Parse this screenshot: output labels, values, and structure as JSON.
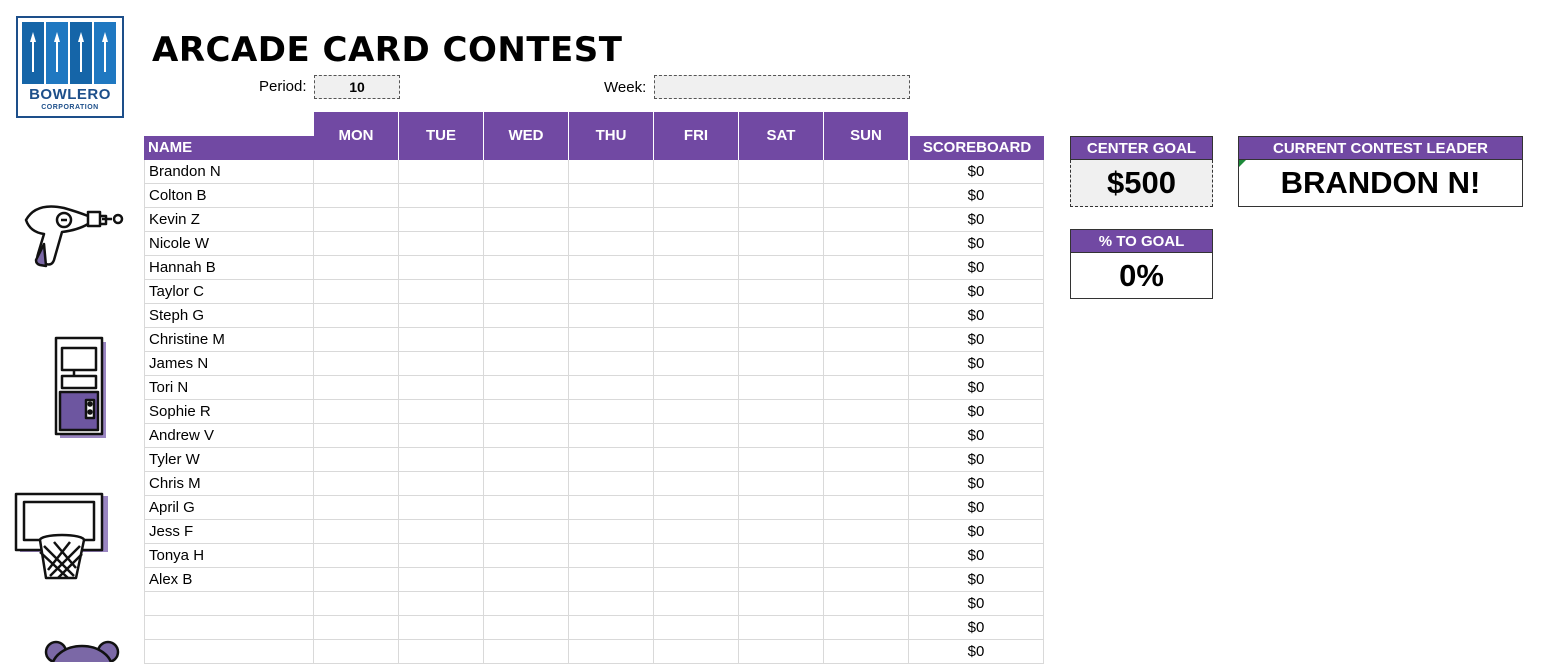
{
  "logo": {
    "name": "BOWLERO",
    "sub": "CORPORATION"
  },
  "title": "ARCADE CARD CONTEST",
  "period": {
    "label": "Period:",
    "value": "10"
  },
  "week": {
    "label": "Week:",
    "value": ""
  },
  "table": {
    "name_header": "NAME",
    "days": [
      "MON",
      "TUE",
      "WED",
      "THU",
      "FRI",
      "SAT",
      "SUN"
    ],
    "score_header": "SCOREBOARD",
    "rows": [
      {
        "name": "Brandon N",
        "score": "$0"
      },
      {
        "name": "Colton B",
        "score": "$0"
      },
      {
        "name": "Kevin Z",
        "score": "$0"
      },
      {
        "name": "Nicole W",
        "score": "$0"
      },
      {
        "name": "Hannah B",
        "score": "$0"
      },
      {
        "name": "Taylor C",
        "score": "$0"
      },
      {
        "name": "Steph G",
        "score": "$0"
      },
      {
        "name": "Christine M",
        "score": "$0"
      },
      {
        "name": "James N",
        "score": "$0"
      },
      {
        "name": "Tori N",
        "score": "$0"
      },
      {
        "name": "Sophie R",
        "score": "$0"
      },
      {
        "name": "Andrew V",
        "score": "$0"
      },
      {
        "name": "Tyler W",
        "score": "$0"
      },
      {
        "name": "Chris M",
        "score": "$0"
      },
      {
        "name": "April G",
        "score": "$0"
      },
      {
        "name": "Jess F",
        "score": "$0"
      },
      {
        "name": "Tonya H",
        "score": "$0"
      },
      {
        "name": "Alex B",
        "score": "$0"
      },
      {
        "name": "",
        "score": "$0"
      },
      {
        "name": "",
        "score": "$0"
      },
      {
        "name": "",
        "score": "$0"
      }
    ]
  },
  "center_goal": {
    "label": "CENTER GOAL",
    "value": "$500"
  },
  "pct_goal": {
    "label": "% TO GOAL",
    "value": "0%"
  },
  "leader": {
    "label": "CURRENT CONTEST LEADER",
    "value": "BRANDON N!"
  },
  "colors": {
    "accent": "#7149a3",
    "brand_blue": "#1565a8"
  },
  "icons": [
    "bowlero-logo",
    "ray-gun-icon",
    "arcade-cabinet-icon",
    "basketball-hoop-icon",
    "teddy-bear-icon"
  ]
}
